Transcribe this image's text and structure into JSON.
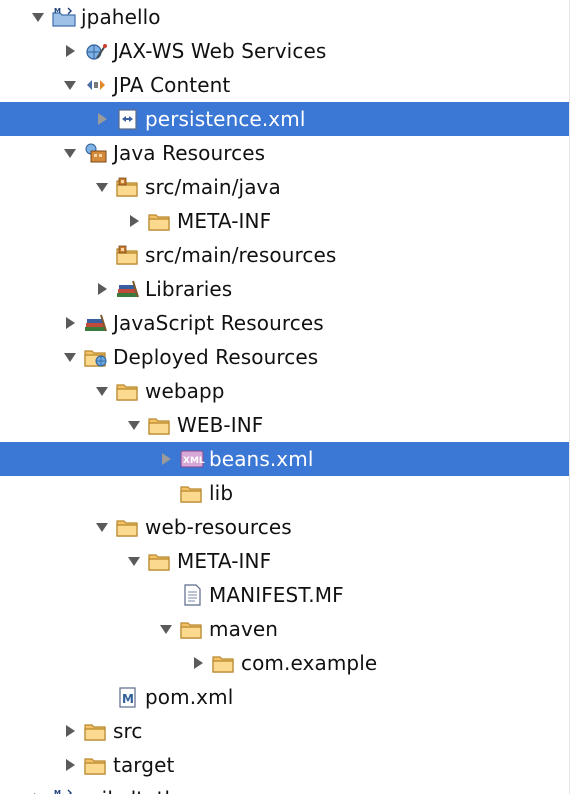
{
  "tree": {
    "items": [
      {
        "label": "jpahello",
        "level": 0,
        "toggle": "expanded",
        "icon": "maven-project-icon",
        "selected": false
      },
      {
        "label": "JAX-WS Web Services",
        "level": 1,
        "toggle": "collapsed",
        "icon": "web-services-icon",
        "selected": false
      },
      {
        "label": "JPA Content",
        "level": 1,
        "toggle": "expanded",
        "icon": "jpa-content-icon",
        "selected": false
      },
      {
        "label": "persistence.xml",
        "level": 2,
        "toggle": "collapsed",
        "icon": "persistence-xml-icon",
        "selected": true
      },
      {
        "label": "Java Resources",
        "level": 1,
        "toggle": "expanded",
        "icon": "java-resources-icon",
        "selected": false
      },
      {
        "label": "src/main/java",
        "level": 2,
        "toggle": "expanded",
        "icon": "source-folder-icon",
        "selected": false
      },
      {
        "label": "META-INF",
        "level": 3,
        "toggle": "collapsed",
        "icon": "folder-icon",
        "selected": false
      },
      {
        "label": "src/main/resources",
        "level": 2,
        "toggle": "none",
        "icon": "source-folder-icon",
        "selected": false
      },
      {
        "label": "Libraries",
        "level": 2,
        "toggle": "collapsed",
        "icon": "libraries-icon",
        "selected": false
      },
      {
        "label": "JavaScript Resources",
        "level": 1,
        "toggle": "collapsed",
        "icon": "libraries-icon",
        "selected": false
      },
      {
        "label": "Deployed Resources",
        "level": 1,
        "toggle": "expanded",
        "icon": "deployed-resources-icon",
        "selected": false
      },
      {
        "label": "webapp",
        "level": 2,
        "toggle": "expanded",
        "icon": "folder-icon",
        "selected": false
      },
      {
        "label": "WEB-INF",
        "level": 3,
        "toggle": "expanded",
        "icon": "folder-icon",
        "selected": false
      },
      {
        "label": "beans.xml",
        "level": 4,
        "toggle": "collapsed",
        "icon": "xml-file-icon",
        "selected": true
      },
      {
        "label": "lib",
        "level": 4,
        "toggle": "none",
        "icon": "folder-icon",
        "selected": false
      },
      {
        "label": "web-resources",
        "level": 2,
        "toggle": "expanded",
        "icon": "folder-icon",
        "selected": false
      },
      {
        "label": "META-INF",
        "level": 3,
        "toggle": "expanded",
        "icon": "folder-icon",
        "selected": false
      },
      {
        "label": "MANIFEST.MF",
        "level": 4,
        "toggle": "none",
        "icon": "text-file-icon",
        "selected": false
      },
      {
        "label": "maven",
        "level": 4,
        "toggle": "expanded",
        "icon": "folder-icon",
        "selected": false
      },
      {
        "label": "com.example",
        "level": 5,
        "toggle": "collapsed",
        "icon": "folder-icon",
        "selected": false
      },
      {
        "label": "pom.xml",
        "level": 2,
        "toggle": "none",
        "icon": "maven-pom-icon",
        "selected": false
      },
      {
        "label": "src",
        "level": 1,
        "toggle": "collapsed",
        "icon": "folder-icon",
        "selected": false
      },
      {
        "label": "target",
        "level": 1,
        "toggle": "collapsed",
        "icon": "folder-icon",
        "selected": false
      },
      {
        "label": "railsdtotheu",
        "level": 0,
        "toggle": "collapsed",
        "icon": "maven-project-icon",
        "selected": false
      }
    ]
  },
  "colors": {
    "selection": "#3b77d4",
    "folder": "#f5c46a",
    "folder_outline": "#b8862c",
    "toggle": "#5a5a5a"
  }
}
